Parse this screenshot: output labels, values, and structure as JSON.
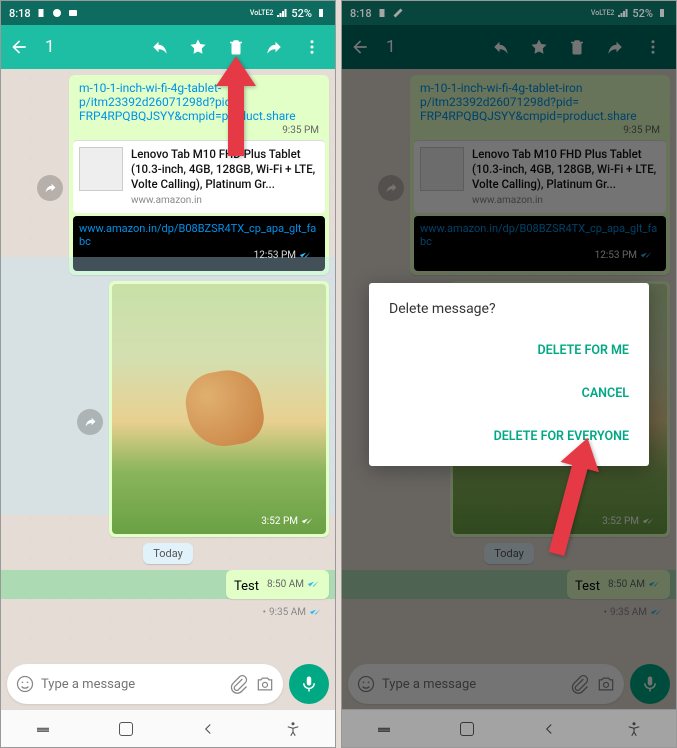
{
  "status": {
    "time": "8:18",
    "net_label": "VoLTE2",
    "battery": "52%"
  },
  "action": {
    "count": "1"
  },
  "messages": {
    "url1": "m-10-1-inch-wi-fi-4g-tablet-",
    "url2": "p/itm23392d26071298d?pid=",
    "url3": "FRP4RPQBQJSYY&cmpid=product.share",
    "url1b": "m-10-1-inch-wi-fi-4g-tablet-iron",
    "preview_title": "Lenovo Tab M10 FHD Plus Tablet (10.3-inch, 4GB, 128GB, Wi-Fi + LTE, Volte Calling), Platinum Gr...",
    "preview_site": "www.amazon.in",
    "amazon_url": "www.amazon.in/dp/B08BZSR4TX_cp_apa_glt_fabc",
    "time1": "9:35 PM",
    "time2": "12:53 PM",
    "time3": "3:52 PM",
    "time4": "8:50 AM",
    "time5": "9:35 AM",
    "today": "Today",
    "test": "Test"
  },
  "input": {
    "placeholder": "Type a message"
  },
  "dialog": {
    "title": "Delete message?",
    "opt1": "DELETE FOR ME",
    "opt2": "CANCEL",
    "opt3": "DELETE FOR EVERYONE"
  }
}
